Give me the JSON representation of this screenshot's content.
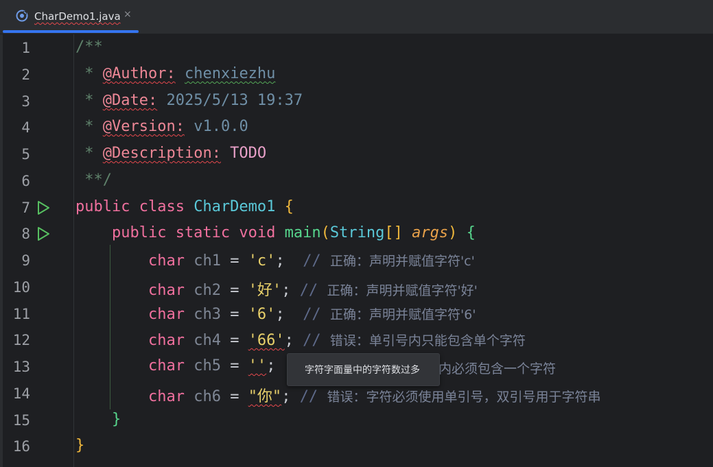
{
  "tab": {
    "title": "CharDemo1.java",
    "close": "×",
    "icon": "java-class-icon"
  },
  "lines": [
    {
      "n": "1"
    },
    {
      "n": "2"
    },
    {
      "n": "3"
    },
    {
      "n": "4"
    },
    {
      "n": "5"
    },
    {
      "n": "6"
    },
    {
      "n": "7"
    },
    {
      "n": "8"
    },
    {
      "n": "9"
    },
    {
      "n": "10"
    },
    {
      "n": "11"
    },
    {
      "n": "12"
    },
    {
      "n": "13"
    },
    {
      "n": "14"
    },
    {
      "n": "15"
    },
    {
      "n": "16"
    }
  ],
  "code": {
    "l1": "/**",
    "l2_star": " * ",
    "l2_tag": "@Author:",
    "l2_val": "chenxiezhu",
    "l3_star": " * ",
    "l3_tag": "@Date:",
    "l3_val": " 2025/5/13 19:37",
    "l4_star": " * ",
    "l4_tag": "@Version:",
    "l4_val": " v1.0.0",
    "l5_star": " * ",
    "l5_tag": "@Description:",
    "l5_val": " TODO",
    "l6": " **/",
    "l7_kw": "public class ",
    "l7_cls": "CharDemo1",
    "l7_brace": " {",
    "l8_kw": "    public static void ",
    "l8_fn": "main",
    "l8_p1": "(",
    "l8_type": "String",
    "l8_br": "[] ",
    "l8_arg": "args",
    "l8_p2": ") ",
    "l8_brace": "{",
    "char_kw": "char",
    "l9_var": " ch1 ",
    "l9_eq": "= ",
    "l9_str": "'c'",
    "l9_semi": ";  ",
    "l9_cmt": "// ",
    "l9_zh": "正确：声明并赋值字符'c'",
    "l10_var": " ch2 ",
    "l10_eq": "= ",
    "l10_str": "'好'",
    "l10_semi": "; ",
    "l10_cmt": "// ",
    "l10_zh": "正确：声明并赋值字符'好'",
    "l11_var": " ch3 ",
    "l11_eq": "= ",
    "l11_str": "'6'",
    "l11_semi": ";  ",
    "l11_cmt": "// ",
    "l11_zh": "正确：声明并赋值字符'6'",
    "l12_var": " ch4 ",
    "l12_eq": "= ",
    "l12_str": "'66'",
    "l12_semi": "; ",
    "l12_cmt": "// ",
    "l12_zh": "错误：单引号内只能包含单个字符",
    "l13_var": " ch5 ",
    "l13_eq": "= ",
    "l13_str": "''",
    "l13_semi": ";",
    "l13_zh": "内必须包含一个字符",
    "l14_var": " ch6 ",
    "l14_eq": "= ",
    "l14_str": "\"你\"",
    "l14_semi": "; ",
    "l14_cmt": "// ",
    "l14_zh": "错误：字符必须使用单引号，双引号用于字符串",
    "l15": "    }",
    "l16": "}"
  },
  "tooltip": {
    "text": "字符字面量中的字符数过多"
  },
  "colors": {
    "background": "#1e1f22",
    "accent": "#3574f0",
    "keyword": "#f0709e",
    "string": "#e8d06a",
    "comment": "#5e6a8a"
  }
}
